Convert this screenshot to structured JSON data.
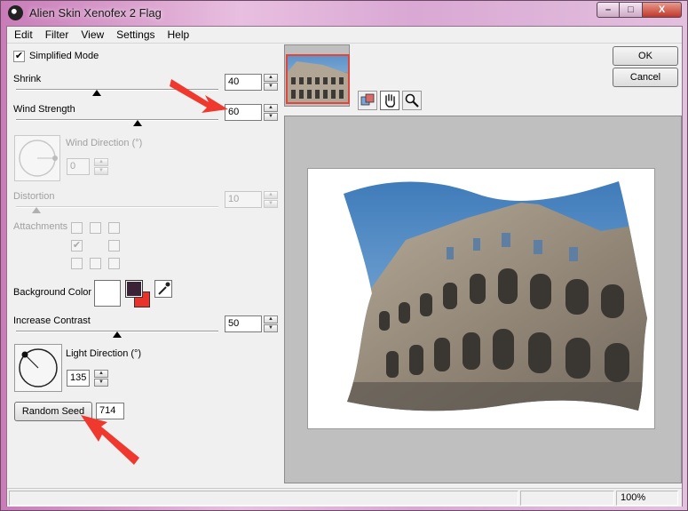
{
  "window": {
    "title": "Alien Skin Xenofex 2 Flag",
    "minimize_glyph": "–",
    "maximize_glyph": "□",
    "close_glyph": "X"
  },
  "menu": [
    "Edit",
    "Filter",
    "View",
    "Settings",
    "Help"
  ],
  "controls": {
    "simplified_mode": {
      "label": "Simplified Mode",
      "checked": true,
      "check_glyph": "✔"
    },
    "shrink": {
      "label": "Shrink",
      "value": "40",
      "slider_fraction": 0.4
    },
    "wind_strength": {
      "label": "Wind Strength",
      "value": "60",
      "slider_fraction": 0.6
    },
    "wind_direction": {
      "label": "Wind Direction (°)",
      "value": "0",
      "disabled": true
    },
    "distortion": {
      "label": "Distortion",
      "value": "10",
      "slider_fraction": 0.1,
      "disabled": true
    },
    "attachments": {
      "label": "Attachments",
      "disabled": true,
      "checked_center_glyph": "✔"
    },
    "background_color": {
      "label": "Background Color",
      "main": "#ffffff",
      "fg": "#3b2236",
      "bg": "#e8322a"
    },
    "increase_contrast": {
      "label": "Increase Contrast",
      "value": "50",
      "slider_fraction": 0.5
    },
    "light_direction": {
      "label": "Light Direction (°)",
      "value": "135"
    },
    "random_seed": {
      "button_label": "Random Seed",
      "value": "714"
    }
  },
  "buttons": {
    "ok": "OK",
    "cancel": "Cancel"
  },
  "status": {
    "zoom": "100%"
  },
  "colors": {
    "annotation_arrow": "#f0392e",
    "thumb_highlight": "#e2453b"
  },
  "icons": [
    "colosseum-thumbnail",
    "compare-icon",
    "hand-pan-icon",
    "zoom-magnifier-icon"
  ]
}
